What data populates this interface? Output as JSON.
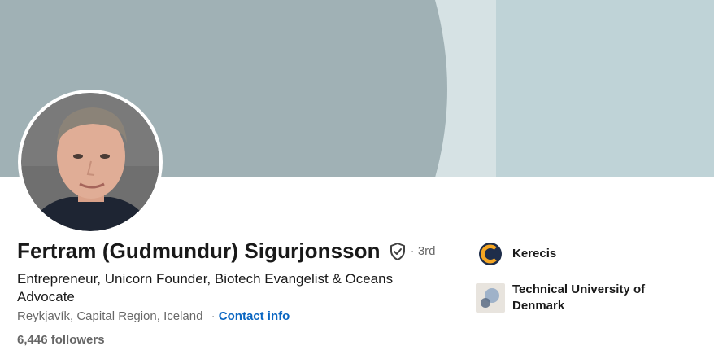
{
  "profile": {
    "name": "Fertram (Gudmundur) Sigurjonsson",
    "degree": "· 3rd",
    "headline": "Entrepreneur, Unicorn Founder, Biotech Evangelist & Oceans Advocate",
    "location": "Reykjavík, Capital Region, Iceland",
    "separator": "·",
    "contact_label": "Contact info",
    "followers": "6,446 followers"
  },
  "icons": {
    "verified": "shield-check-icon",
    "kerecis_logo": "kerecis-logo-icon",
    "dtu_logo": "university-logo-icon"
  },
  "organizations": [
    {
      "name": "Kerecis"
    },
    {
      "name": "Technical University of Denmark"
    }
  ],
  "colors": {
    "banner_dark": "#a0b1b5",
    "banner_light": "#bfd3d7",
    "banner_mid": "#d6e2e4",
    "link": "#0a66c2",
    "kerecis_dark": "#1e2d4a",
    "kerecis_accent": "#f5a623"
  }
}
